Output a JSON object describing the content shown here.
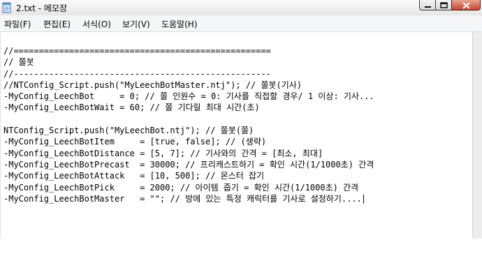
{
  "window": {
    "title": "2.txt - 메모장"
  },
  "menu": [
    {
      "label": "파일(F)"
    },
    {
      "label": "편집(E)"
    },
    {
      "label": "서식(O)"
    },
    {
      "label": "보기(V)"
    },
    {
      "label": "도움말(H)"
    }
  ],
  "editor": {
    "lines": [
      "//===================================================",
      "// 쫄봇",
      "//---------------------------------------------------",
      "//NTConfig_Script.push(\"MyLeechBotMaster.ntj\"); // 쫄봇(기사)",
      "-MyConfig_LeechBot     = 0; // 쫄 인원수 = 0: 기사를 직접할 경우/ 1 이상: 기사...",
      "-MyConfig_LeechBotWait = 60; // 쫄 기다릴 최대 시간(초)",
      "",
      "NTConfig_Script.push(\"MyLeechBot.ntj\"); // 쫄봇(쫄)",
      "-MyConfig_LeechBotItem     = [true, false]; // (생략)",
      "-MyConfig_LeechBotDistance = [5, 7]; // 기사와의 간격 = [최소, 최대]",
      "-MyConfig_LeechBotPrecast  = 30000; // 프리캐스트하기 = 확인 시간(1/1000초) 간격",
      "-MyConfig_LeechBotAttack   = [10, 500]; // 몬스터 잡기",
      "-MyConfig_LeechBotPick     = 2000; // 아이템 줍기 = 확인 시간(1/1000초) 간격",
      "-MyConfig_LeechBotMaster   = \"\"; // 방에 있는 특정 캐릭터를 기사로 설정하기...."
    ]
  }
}
